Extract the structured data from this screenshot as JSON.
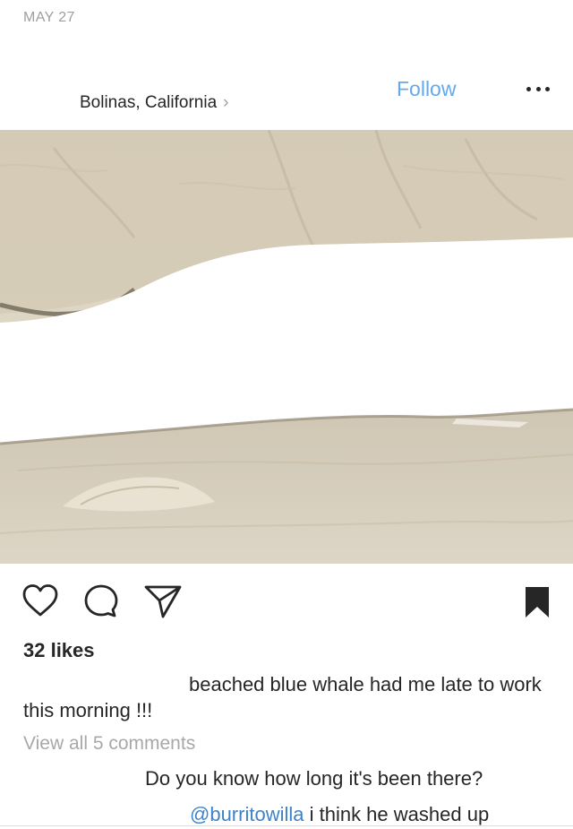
{
  "post": {
    "date": "MAY 27",
    "location": "Bolinas, California",
    "location_chevron": "›",
    "follow_label": "Follow",
    "image_colors": {
      "sand_light": "#e8e1d3",
      "sand_mid": "#d6ccb8",
      "sand_dark": "#b9ae98",
      "water_line": "#7d7566"
    },
    "icons": [
      "heart-icon",
      "comment-icon",
      "share-icon",
      "bookmark-icon",
      "more-options-icon"
    ],
    "likes": "32 likes",
    "caption": "beached blue whale had me late to work this morning !!!",
    "view_all_comments": "View all 5 comments",
    "comments": [
      {
        "text": "Do you know how long it's been there?"
      },
      {
        "mention": "@burritowilla",
        "text": " i think he washed up"
      }
    ]
  },
  "colors": {
    "accent": "#64a8ee",
    "mention": "#3f82c9",
    "muted": "#a8a8a8",
    "text": "#262626"
  }
}
